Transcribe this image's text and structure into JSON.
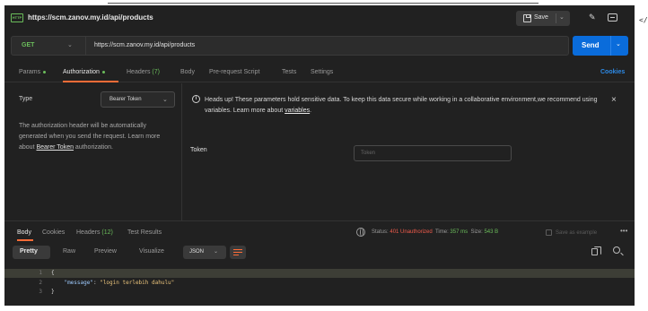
{
  "titlebar": {
    "method_badge": "GET",
    "title": "https://scm.zanov.my.id/api/products",
    "save_label": "Save"
  },
  "request": {
    "method": "GET",
    "url": "https://scm.zanov.my.id/api/products",
    "send_label": "Send"
  },
  "req_tabs": {
    "params": "Params",
    "authorization": "Authorization",
    "headers": "Headers",
    "headers_count": "(7)",
    "body": "Body",
    "prerequest": "Pre-request Script",
    "tests": "Tests",
    "settings": "Settings",
    "cookies": "Cookies"
  },
  "auth": {
    "type_label": "Type",
    "type_value": "Bearer Token",
    "desc_1": "The authorization header will be automatically generated when you send the request. Learn more about ",
    "desc_link": "Bearer Token",
    "desc_2": " authorization.",
    "notice_1": "Heads up! These parameters hold sensitive data. To keep this data secure while working in a collaborative environment,we recommend using variables. Learn more about ",
    "notice_link": "variables",
    "notice_2": ".",
    "token_label": "Token",
    "token_placeholder": "Token"
  },
  "response": {
    "tabs": {
      "body": "Body",
      "cookies": "Cookies",
      "headers": "Headers",
      "headers_count": "(12)",
      "test_results": "Test Results"
    },
    "status_label": "Status:",
    "status_value": "401 Unauthorized",
    "time_label": "Time:",
    "time_value": "357 ms",
    "size_label": "Size:",
    "size_value": "543 B",
    "save_example": "Save as example",
    "formats": {
      "pretty": "Pretty",
      "raw": "Raw",
      "preview": "Preview",
      "visualize": "Visualize",
      "json": "JSON"
    },
    "code": {
      "line1_no": "1",
      "line2_no": "2",
      "line3_no": "3",
      "line1": "{",
      "key": "\"message\"",
      "colon": ": ",
      "value": "\"login terlebih dahulu\"",
      "line3": "}"
    }
  },
  "icons": {
    "http": "http-request-icon",
    "save": "save-icon",
    "edit": "pencil-icon",
    "comments": "comment-icon",
    "info": "info-icon",
    "close": "close-icon",
    "globe": "globe-icon",
    "copy": "copy-icon",
    "search": "search-icon",
    "wrap": "wrap-lines-icon"
  },
  "colors": {
    "accent": "#ff6c37",
    "send": "#0a6cdb",
    "get": "#6bbd5b",
    "error": "#ef5b4b"
  }
}
